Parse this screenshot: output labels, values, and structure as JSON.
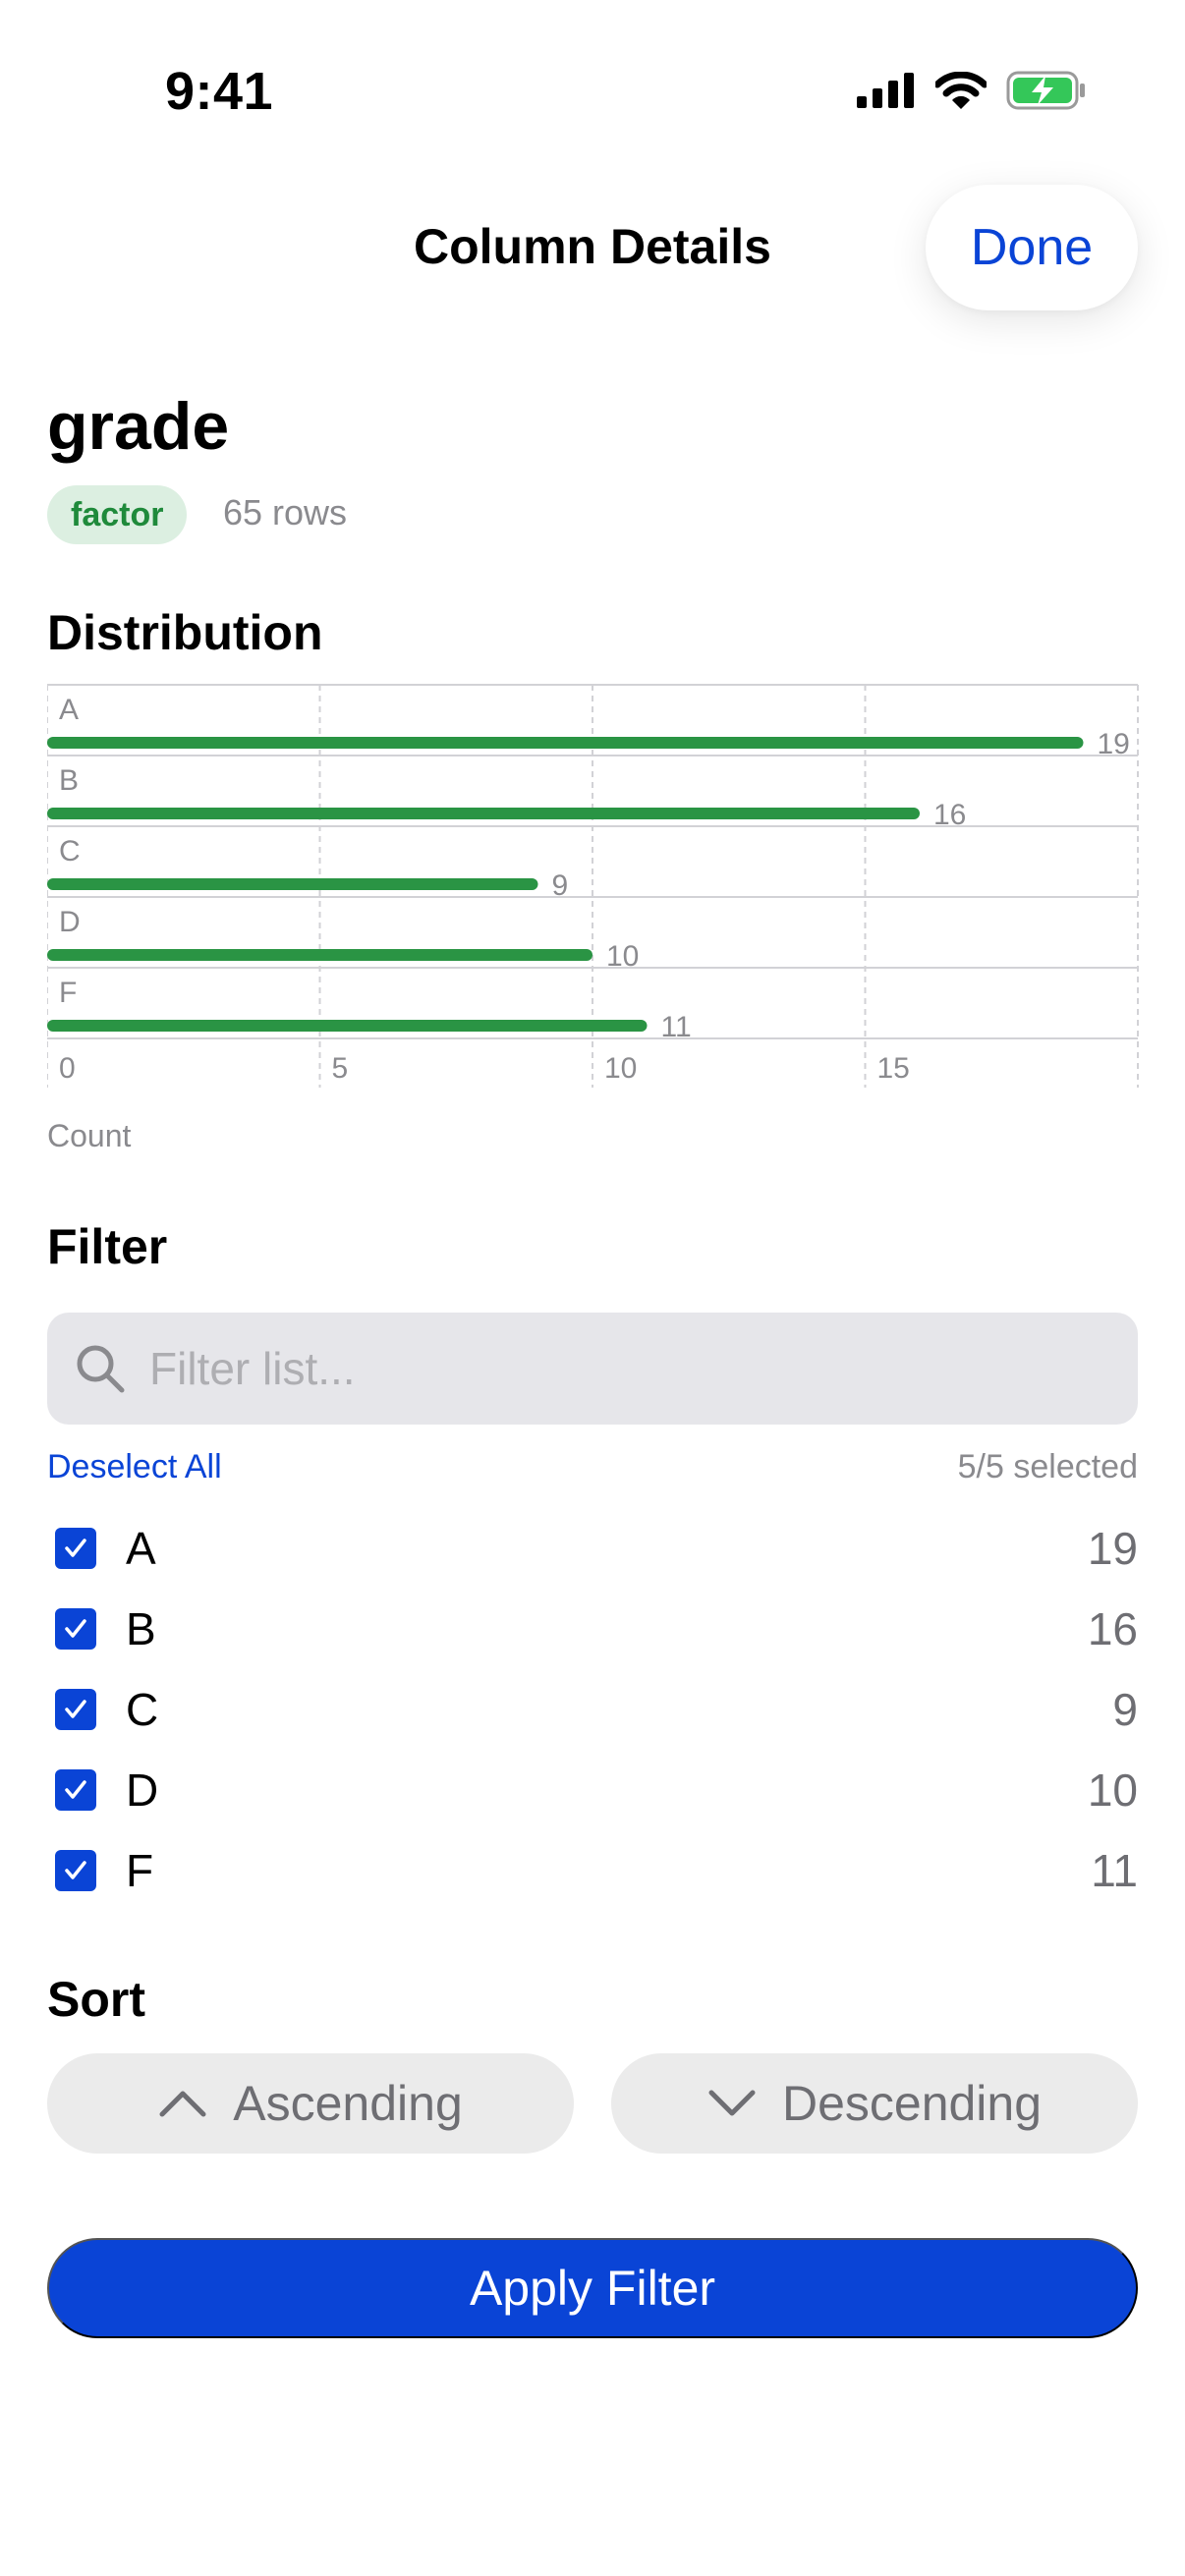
{
  "status_bar": {
    "time": "9:41"
  },
  "nav": {
    "title": "Column Details",
    "done_label": "Done"
  },
  "column": {
    "name": "grade",
    "type_chip": "factor",
    "rows_text": "65 rows"
  },
  "distribution": {
    "title": "Distribution",
    "axis_caption": "Count"
  },
  "chart_data": {
    "type": "bar",
    "orientation": "horizontal",
    "categories": [
      "A",
      "B",
      "C",
      "D",
      "F"
    ],
    "values": [
      19,
      16,
      9,
      10,
      11
    ],
    "xlabel": "Count",
    "xlim": [
      0,
      20
    ],
    "xticks": [
      0,
      5,
      10,
      15
    ],
    "grid": true,
    "bar_color": "#2a9444"
  },
  "filter": {
    "title": "Filter",
    "search_placeholder": "Filter list...",
    "deselect_label": "Deselect All",
    "selected_text": "5/5 selected",
    "options": [
      {
        "label": "A",
        "count": "19",
        "checked": true
      },
      {
        "label": "B",
        "count": "16",
        "checked": true
      },
      {
        "label": "C",
        "count": "9",
        "checked": true
      },
      {
        "label": "D",
        "count": "10",
        "checked": true
      },
      {
        "label": "F",
        "count": "11",
        "checked": true
      }
    ]
  },
  "sort": {
    "title": "Sort",
    "ascending_label": "Ascending",
    "descending_label": "Descending"
  },
  "apply_label": "Apply Filter",
  "colors": {
    "accent": "#0a44d6",
    "bar": "#2a9444",
    "chip_bg": "#dcefe1",
    "chip_text": "#1f8a3b"
  }
}
